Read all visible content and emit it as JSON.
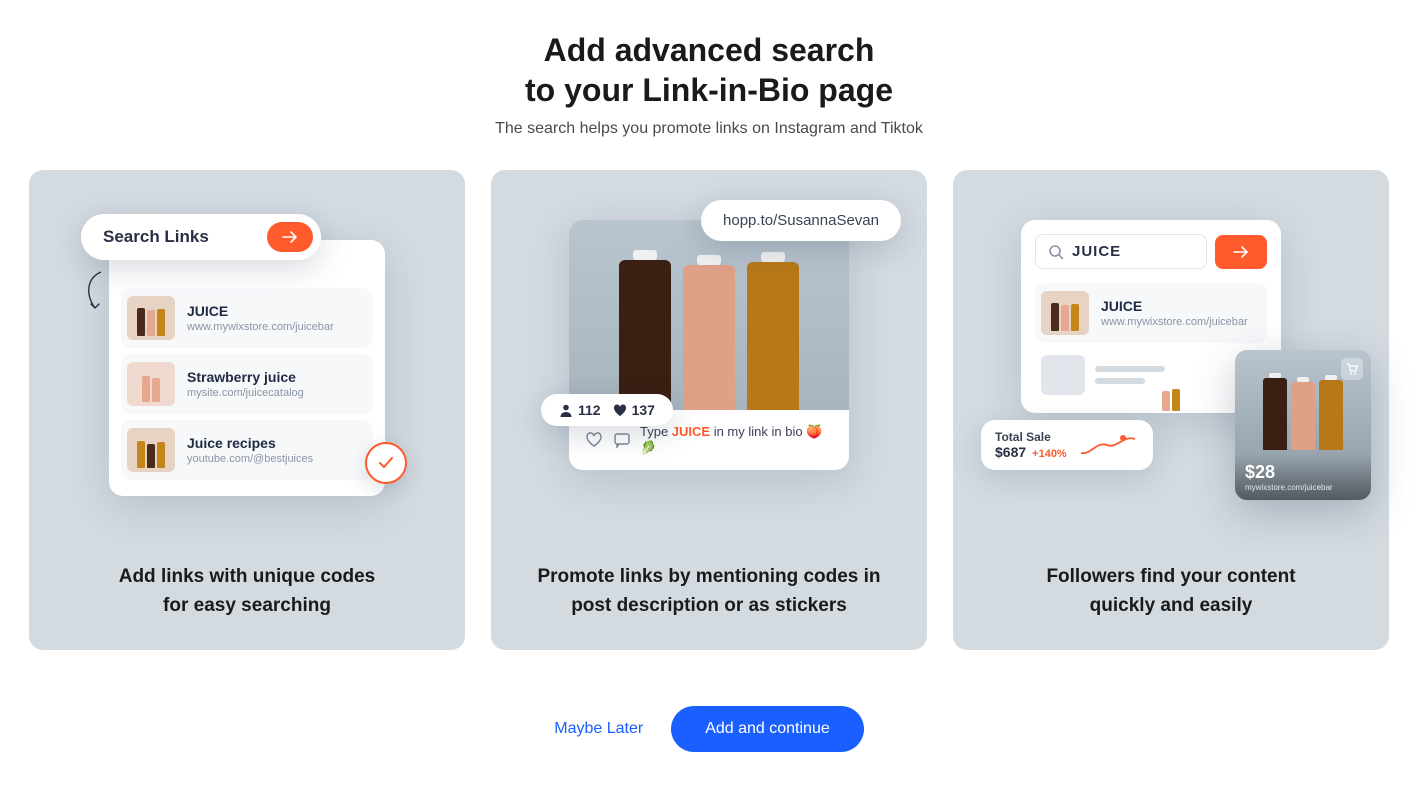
{
  "header": {
    "title_line1": "Add advanced search",
    "title_line2": "to your Link-in-Bio page",
    "subtitle": "The search helps you promote links on Instagram and Tiktok"
  },
  "cards": [
    {
      "caption_line1": "Add links with unique codes",
      "caption_line2": "for easy searching",
      "search_label": "Search Links",
      "links": [
        {
          "title": "JUICE",
          "url": "www.mywixstore.com/juicebar"
        },
        {
          "title": "Strawberry juice",
          "url": "mysite.com/juicecatalog"
        },
        {
          "title": "Juice recipes",
          "url": "youtube.com/@bestjuices"
        }
      ]
    },
    {
      "caption_line1": "Promote links by mentioning codes in",
      "caption_line2": "post description or as stickers",
      "url_pill": "hopp.to/SusannaSevan",
      "stats": {
        "followers": "112",
        "likes": "137"
      },
      "footer_prefix": "Type ",
      "footer_keyword": "JUICE",
      "footer_suffix": " in my link in bio 🍑🥬"
    },
    {
      "caption_line1": "Followers find your content",
      "caption_line2": "quickly and easily",
      "search_value": "JUICE",
      "result": {
        "title": "JUICE",
        "url": "www.mywixstore.com/juicebar"
      },
      "sale": {
        "label": "Total Sale",
        "amount": "$687",
        "pct": "+140%"
      },
      "product": {
        "price": "$28",
        "url": "mywixstore.com/juicebar"
      }
    }
  ],
  "actions": {
    "secondary": "Maybe Later",
    "primary": "Add and continue"
  },
  "colors": {
    "accent": "#ff5a2c",
    "primary": "#1a5fff"
  }
}
